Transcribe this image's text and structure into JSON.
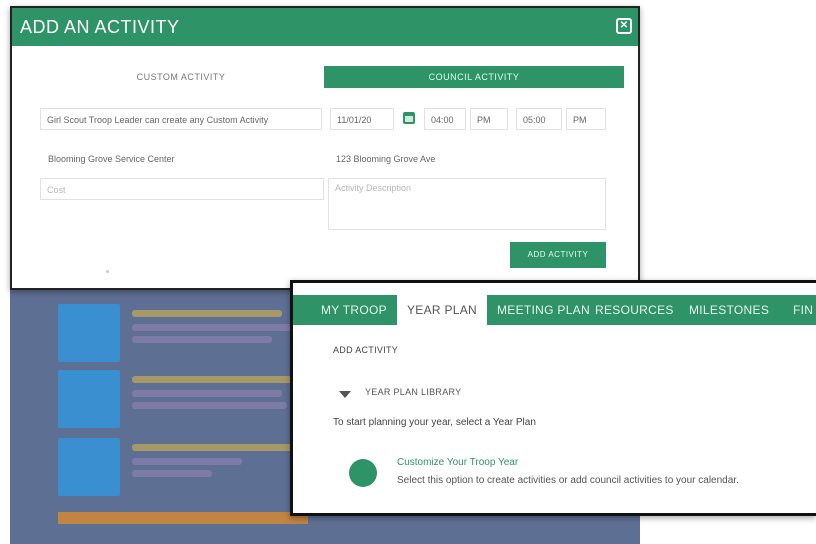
{
  "modal": {
    "title": "ADD AN ACTIVITY",
    "close_icon": "close-icon",
    "subtitle": "",
    "tabs": [
      {
        "label": "CUSTOM ACTIVITY",
        "active": false
      },
      {
        "label": "COUNCIL ACTIVITY",
        "active": true
      }
    ],
    "activity_name": "Girl Scout Troop Leader can create any Custom Activity",
    "start_date": "11/01/20",
    "start_time": "04:00",
    "start_ampm": "PM",
    "end_time": "05:00",
    "end_ampm": "PM",
    "location_name": "Blooming Grove Service Center",
    "address": "123 Blooming Grove Ave",
    "cost_placeholder": "Cost",
    "description_placeholder": "Activity Description",
    "add_button": "ADD ACTIVITY"
  },
  "panel": {
    "nav_tabs": [
      {
        "label": "MY TROOP",
        "active": false
      },
      {
        "label": "YEAR PLAN",
        "active": true
      },
      {
        "label": "MEETING PLAN",
        "active": false
      },
      {
        "label": "RESOURCES",
        "active": false
      },
      {
        "label": "MILESTONES",
        "active": false
      },
      {
        "label": "FIN",
        "active": false
      }
    ],
    "add_activity_link": "ADD ACTIVITY",
    "library_label": "YEAR PLAN LIBRARY",
    "start_text": "To start planning your year, select a Year Plan",
    "customize_title": "Customize Your Troop Year",
    "customize_desc": "Select this option to create activities or add council activities to your calendar."
  },
  "colors": {
    "brand_green": "#2e9366",
    "background_overlay": "#5e6f94"
  }
}
